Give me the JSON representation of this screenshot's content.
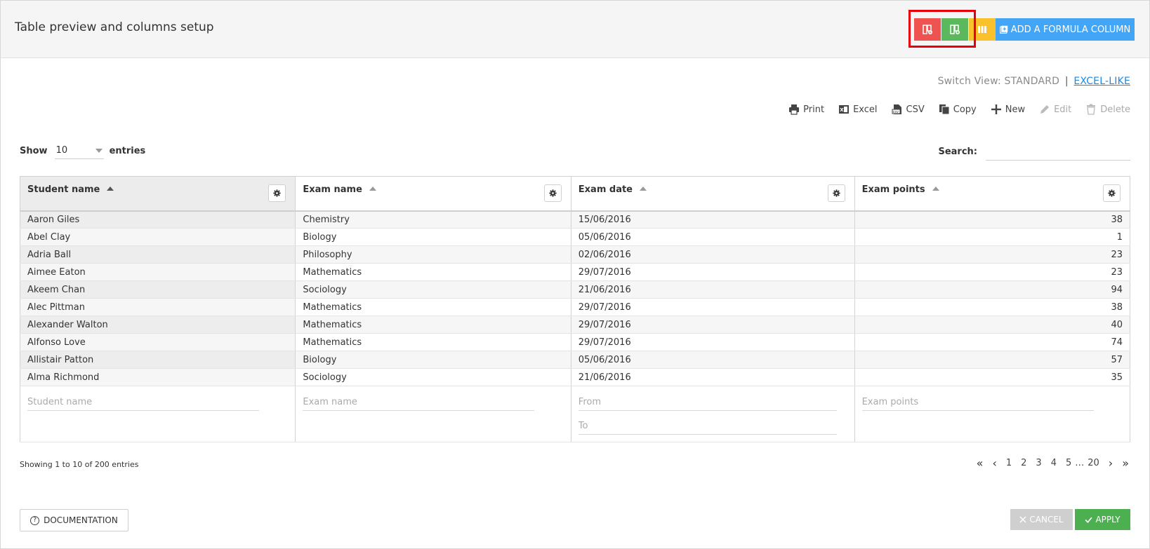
{
  "header": {
    "title": "Table preview and columns setup",
    "formula_button_label": "ADD A FORMULA COLUMN"
  },
  "switch_view": {
    "prefix": "Switch View: STANDARD",
    "separator": "|",
    "link": "EXCEL-LIKE"
  },
  "toolbar": {
    "print": "Print",
    "excel": "Excel",
    "csv": "CSV",
    "copy": "Copy",
    "new": "New",
    "edit": "Edit",
    "delete": "Delete"
  },
  "show": {
    "label": "Show",
    "value": "10",
    "suffix": "entries"
  },
  "search": {
    "label": "Search:"
  },
  "columns": [
    "Student name",
    "Exam name",
    "Exam date",
    "Exam points"
  ],
  "rows": [
    [
      "Aaron Giles",
      "Chemistry",
      "15/06/2016",
      "38"
    ],
    [
      "Abel Clay",
      "Biology",
      "05/06/2016",
      "1"
    ],
    [
      "Adria Ball",
      "Philosophy",
      "02/06/2016",
      "23"
    ],
    [
      "Aimee Eaton",
      "Mathematics",
      "29/07/2016",
      "23"
    ],
    [
      "Akeem Chan",
      "Sociology",
      "21/06/2016",
      "94"
    ],
    [
      "Alec Pittman",
      "Mathematics",
      "29/07/2016",
      "38"
    ],
    [
      "Alexander Walton",
      "Mathematics",
      "29/07/2016",
      "40"
    ],
    [
      "Alfonso Love",
      "Mathematics",
      "29/07/2016",
      "74"
    ],
    [
      "Allistair Patton",
      "Biology",
      "05/06/2016",
      "57"
    ],
    [
      "Alma Richmond",
      "Sociology",
      "21/06/2016",
      "35"
    ]
  ],
  "filters": {
    "student_name": "Student name",
    "exam_name": "Exam name",
    "date_from": "From",
    "date_to": "To",
    "exam_points": "Exam points"
  },
  "info": "Showing 1 to 10 of 200 entries",
  "pagination": {
    "first": "«",
    "prev": "‹",
    "pages": [
      "1",
      "2",
      "3",
      "4",
      "5"
    ],
    "ellipsis": "…",
    "last_page": "20",
    "next": "›",
    "last": "»"
  },
  "footer": {
    "documentation": "DOCUMENTATION",
    "cancel": "CANCEL",
    "apply": "APPLY"
  },
  "colors": {
    "red_button": "#ef5350",
    "green_button": "#5cb85c",
    "yellow_button": "#f9c12b",
    "blue_button": "#42a5f5",
    "apply_button": "#4caf50",
    "highlight_box": "#e8000b"
  },
  "icons": {
    "red_button": "column-remove-icon",
    "green_button": "column-add-icon",
    "yellow_button": "columns-icon",
    "formula_button": "add-box-icon",
    "column_settings": "gear-icon"
  }
}
